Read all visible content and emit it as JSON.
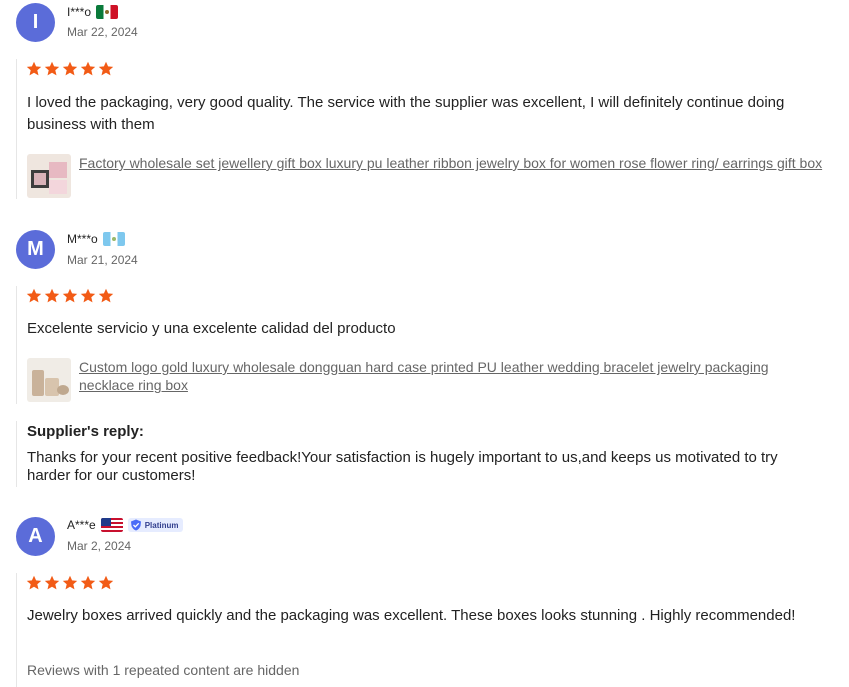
{
  "star_color": "#f25b16",
  "avatar_color": "#5b6cd9",
  "reviews": [
    {
      "initial": "I",
      "name": "I***o",
      "flag": "mexico-flag",
      "date": "Mar 22, 2024",
      "rating": 5,
      "text": "I loved the packaging, very good quality. The service with the supplier was excellent, I will definitely continue doing business with them",
      "product": "Factory wholesale set jewellery gift box luxury pu leather ribbon jewelry box for women rose flower ring/ earrings gift box"
    },
    {
      "initial": "M",
      "name": "M***o",
      "flag": "guatemala-flag",
      "date": "Mar 21, 2024",
      "rating": 5,
      "text": "Excelente servicio y una excelente calidad del producto",
      "product": "Custom logo gold luxury wholesale dongguan hard case printed PU leather wedding bracelet jewelry packaging necklace ring box",
      "reply_title": "Supplier's reply:",
      "reply_text": "Thanks for your recent positive feedback!Your satisfaction is hugely important to us,and keeps us motivated to try harder for our customers!"
    },
    {
      "initial": "A",
      "name": "A***e",
      "flag": "usa-flag",
      "badge": "Platinum",
      "date": "Mar 2, 2024",
      "rating": 5,
      "text": "Jewelry boxes arrived quickly and the packaging was excellent. These boxes looks stunning . Highly recommended!",
      "note": "Reviews with 1 repeated content are hidden"
    }
  ]
}
